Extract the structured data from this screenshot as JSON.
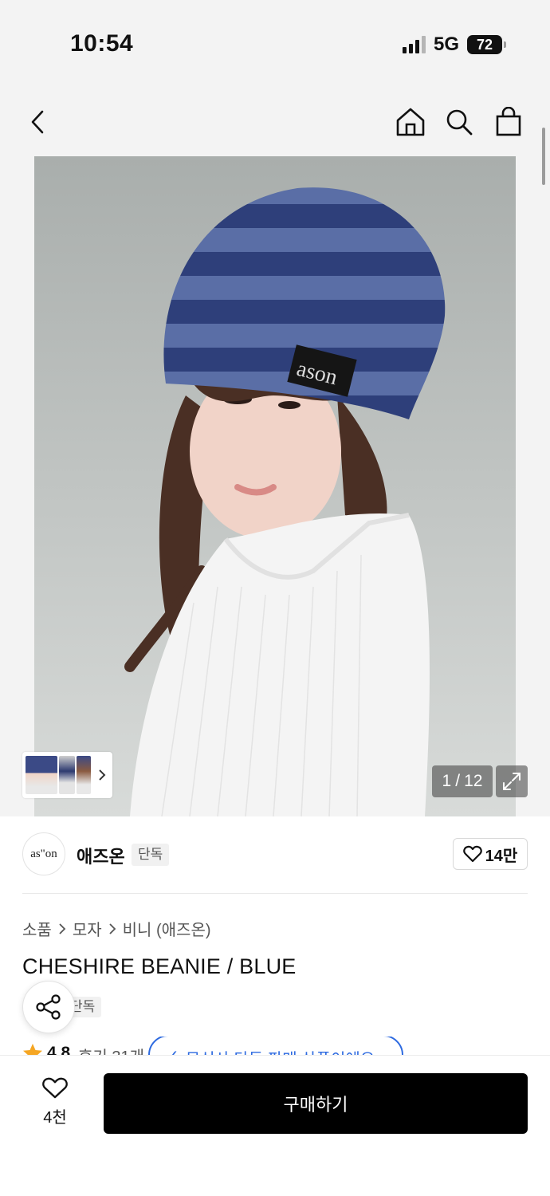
{
  "status_bar": {
    "time": "10:54",
    "network": "5G",
    "battery": "72"
  },
  "nav": {
    "back_icon": "chevron-left-icon",
    "home_icon": "home-icon",
    "search_icon": "search-icon",
    "bag_icon": "shopping-bag-icon"
  },
  "gallery": {
    "hero_alt": "",
    "hat_label": "ason",
    "counter_current": "1",
    "counter_sep": "/",
    "counter_total": "12",
    "expand_icon": "expand-icon"
  },
  "brand": {
    "logo_text": "as\"on",
    "name": "애즈온",
    "badge": "단독",
    "like_count": "14만"
  },
  "breadcrumb": [
    "소품",
    "모자",
    "비니 (애즈온)"
  ],
  "product": {
    "title": "CHESHIRE BEANIE / BLUE",
    "exclusive_badge": "단독",
    "rating": "4.8",
    "reviews": "후기 31개",
    "exclusive_note": "무신사 단독 판매 상품이에요"
  },
  "bottom_bar": {
    "wish_count": "4천",
    "buy_label": "구매하기"
  },
  "colors": {
    "accent_blue": "#2d6ae0",
    "star": "#f5a623",
    "buy_bg": "#000000"
  }
}
